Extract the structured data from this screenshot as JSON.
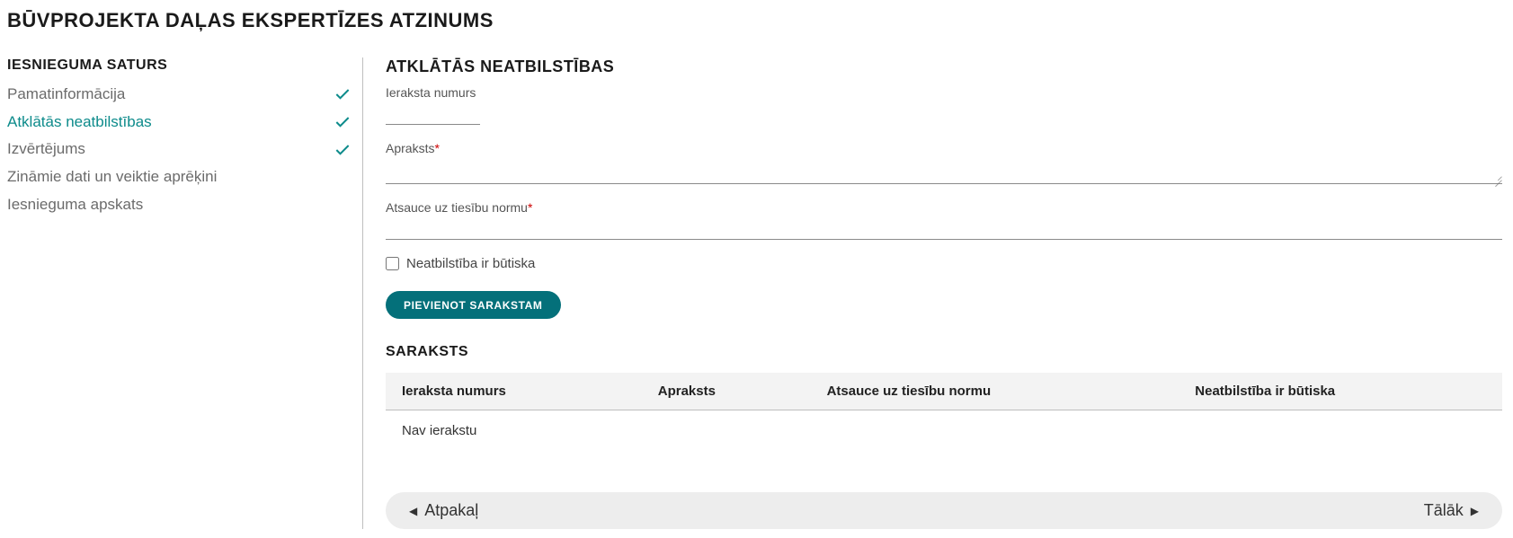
{
  "page_title": "Būvprojekta daļas ekspertīzes atzinums",
  "sidebar": {
    "title": "Iesnieguma saturs",
    "items": [
      {
        "label": "Pamatinformācija",
        "checked": true,
        "active": false
      },
      {
        "label": "Atklātās neatbilstības",
        "checked": true,
        "active": true
      },
      {
        "label": "Izvērtējums",
        "checked": true,
        "active": false
      },
      {
        "label": "Zināmie dati un veiktie aprēķini",
        "checked": false,
        "active": false
      },
      {
        "label": "Iesnieguma apskats",
        "checked": false,
        "active": false
      }
    ]
  },
  "main": {
    "title": "Atklātās neatbilstības",
    "fields": {
      "ieraksta_numurs_label": "Ieraksta numurs",
      "ieraksta_numurs_value": "",
      "apraksts_label": "Apraksts",
      "apraksts_value": "",
      "atsauce_label": "Atsauce uz tiesību normu",
      "atsauce_value": "",
      "butiska_label": "Neatbilstība ir būtiska"
    },
    "add_button": "Pievienot sarakstam",
    "list_title": "Saraksts",
    "table": {
      "headers": [
        "Ieraksta numurs",
        "Apraksts",
        "Atsauce uz tiesību normu",
        "Neatbilstība ir būtiska"
      ],
      "empty_text": "Nav ierakstu"
    }
  },
  "nav": {
    "back": "Atpakaļ",
    "next": "Tālāk"
  }
}
